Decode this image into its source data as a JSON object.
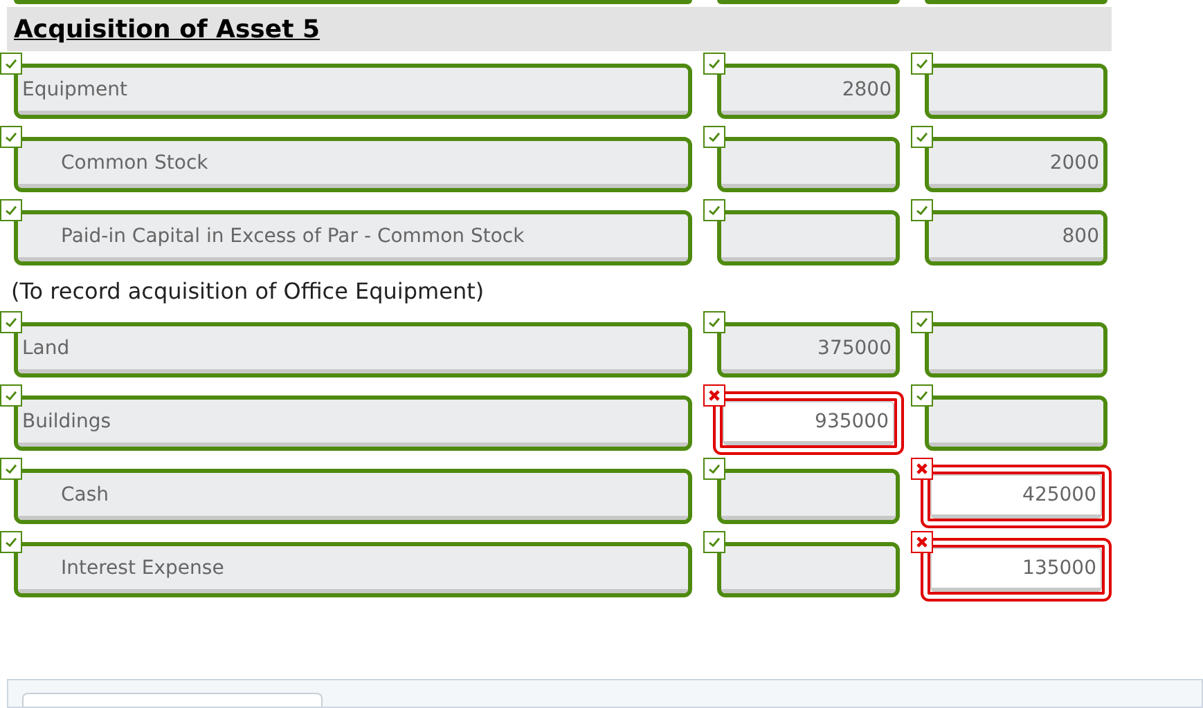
{
  "heading": "Acquisition of Asset 5",
  "rows": [
    {
      "kind": "entry",
      "account": {
        "text": "Equipment",
        "indented": false,
        "correct": true
      },
      "debit": {
        "value": "2800",
        "correct": true
      },
      "credit": {
        "correct": true
      }
    },
    {
      "kind": "entry",
      "account": {
        "text": "Common Stock",
        "indented": true,
        "correct": true
      },
      "debit": {
        "correct": true
      },
      "credit": {
        "value": "2000",
        "correct": true
      }
    },
    {
      "kind": "entry",
      "account": {
        "text": "Paid-in Capital in Excess of Par - Common Stock",
        "indented": true,
        "correct": true
      },
      "debit": {
        "correct": true
      },
      "credit": {
        "value": "800",
        "correct": true
      }
    },
    {
      "kind": "note",
      "text": "(To record acquisition of Office Equipment)"
    },
    {
      "kind": "entry",
      "account": {
        "text": "Land",
        "indented": false,
        "correct": true
      },
      "debit": {
        "value": "375000",
        "correct": true
      },
      "credit": {
        "correct": true
      }
    },
    {
      "kind": "entry",
      "account": {
        "text": "Buildings",
        "indented": false,
        "correct": true
      },
      "debit": {
        "value": "935000",
        "correct": false
      },
      "credit": {
        "correct": true
      }
    },
    {
      "kind": "entry",
      "account": {
        "text": "Cash",
        "indented": true,
        "correct": true
      },
      "debit": {
        "correct": true
      },
      "credit": {
        "value": "425000",
        "correct": false
      }
    },
    {
      "kind": "entry",
      "account": {
        "text": "Interest Expense",
        "indented": true,
        "correct": true
      },
      "debit": {
        "correct": true
      },
      "credit": {
        "value": "135000",
        "correct": false
      }
    }
  ]
}
